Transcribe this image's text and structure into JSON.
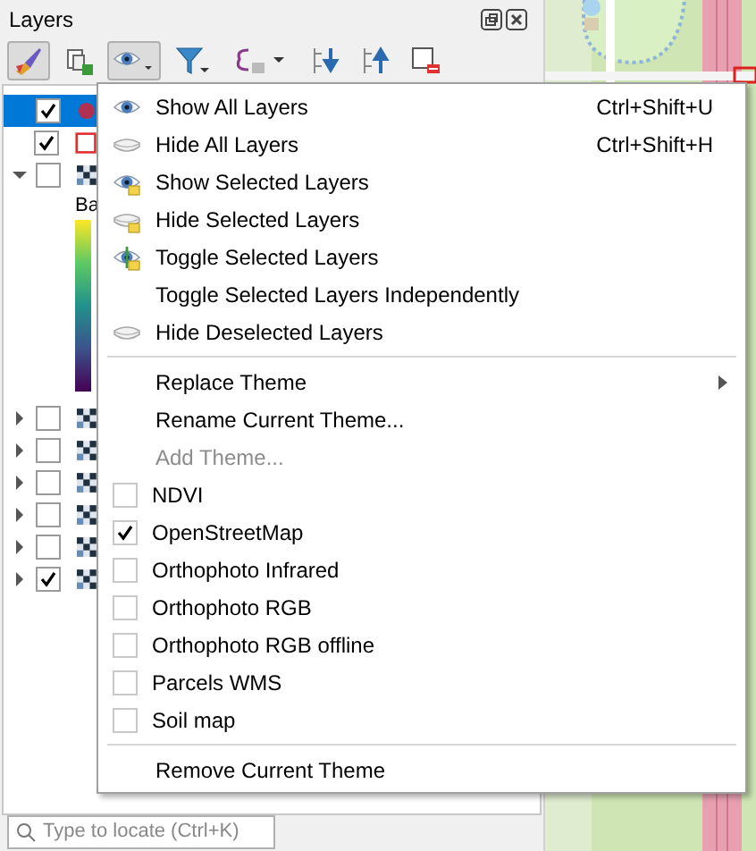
{
  "panel": {
    "title": "Layers"
  },
  "toolbar": [
    {
      "kind": "brush",
      "pressed": true
    },
    {
      "kind": "group",
      "pressed": false
    },
    {
      "kind": "eye",
      "pressed": true
    },
    {
      "kind": "filter",
      "pressed": false
    },
    {
      "kind": "expression",
      "pressed": false
    },
    {
      "kind": "expand",
      "pressed": false
    },
    {
      "kind": "collapse",
      "pressed": false
    },
    {
      "kind": "remove",
      "pressed": false
    }
  ],
  "layers": [
    {
      "kind": "point",
      "checked": true,
      "selected": true
    },
    {
      "kind": "polygon",
      "checked": true,
      "selected": false
    },
    {
      "kind": "raster",
      "checked": false,
      "selected": false,
      "expanded": true,
      "children": [
        {
          "kind": "ramp",
          "label": "Ba"
        }
      ]
    },
    {
      "kind": "raster",
      "checked": false,
      "selected": false,
      "expanded": false
    },
    {
      "kind": "raster",
      "checked": false,
      "selected": false,
      "expanded": false
    },
    {
      "kind": "raster",
      "checked": false,
      "selected": false,
      "expanded": false
    },
    {
      "kind": "raster",
      "checked": false,
      "selected": false,
      "expanded": false
    },
    {
      "kind": "raster",
      "checked": false,
      "selected": false,
      "expanded": false
    },
    {
      "kind": "raster",
      "checked": true,
      "selected": false,
      "expanded": false
    }
  ],
  "search": {
    "placeholder": "Type to locate (Ctrl+K)"
  },
  "menu": [
    {
      "kind": "show",
      "label": "Show All Layers",
      "shortcut": "Ctrl+Shift+U",
      "disabled": false
    },
    {
      "kind": "hide",
      "label": "Hide All Layers",
      "shortcut": "Ctrl+Shift+H",
      "disabled": false
    },
    {
      "kind": "showsel",
      "label": "Show Selected Layers",
      "disabled": false
    },
    {
      "kind": "hidesel",
      "label": "Hide Selected Layers",
      "disabled": false
    },
    {
      "kind": "toggle",
      "label": "Toggle Selected Layers",
      "disabled": false
    },
    {
      "kind": "plain",
      "label": "Toggle Selected Layers Independently",
      "disabled": false
    },
    {
      "kind": "hide",
      "label": "Hide Deselected Layers",
      "disabled": false
    },
    {
      "kind": "separator"
    },
    {
      "kind": "submenu",
      "label": "Replace Theme",
      "disabled": false
    },
    {
      "kind": "plain",
      "label": "Rename Current Theme...",
      "disabled": false
    },
    {
      "kind": "plain",
      "label": "Add Theme...",
      "disabled": true
    },
    {
      "kind": "check",
      "label": "NDVI",
      "checked": false,
      "disabled": false
    },
    {
      "kind": "check",
      "label": "OpenStreetMap",
      "checked": true,
      "disabled": false
    },
    {
      "kind": "check",
      "label": "Orthophoto Infrared",
      "checked": false,
      "disabled": false
    },
    {
      "kind": "check",
      "label": "Orthophoto RGB",
      "checked": false,
      "disabled": false
    },
    {
      "kind": "check",
      "label": "Orthophoto RGB offline",
      "checked": false,
      "disabled": false
    },
    {
      "kind": "check",
      "label": "Parcels WMS",
      "checked": false,
      "disabled": false
    },
    {
      "kind": "check",
      "label": "Soil map",
      "checked": false,
      "disabled": false
    },
    {
      "kind": "separator"
    },
    {
      "kind": "plain",
      "label": "Remove Current Theme",
      "disabled": false
    }
  ]
}
